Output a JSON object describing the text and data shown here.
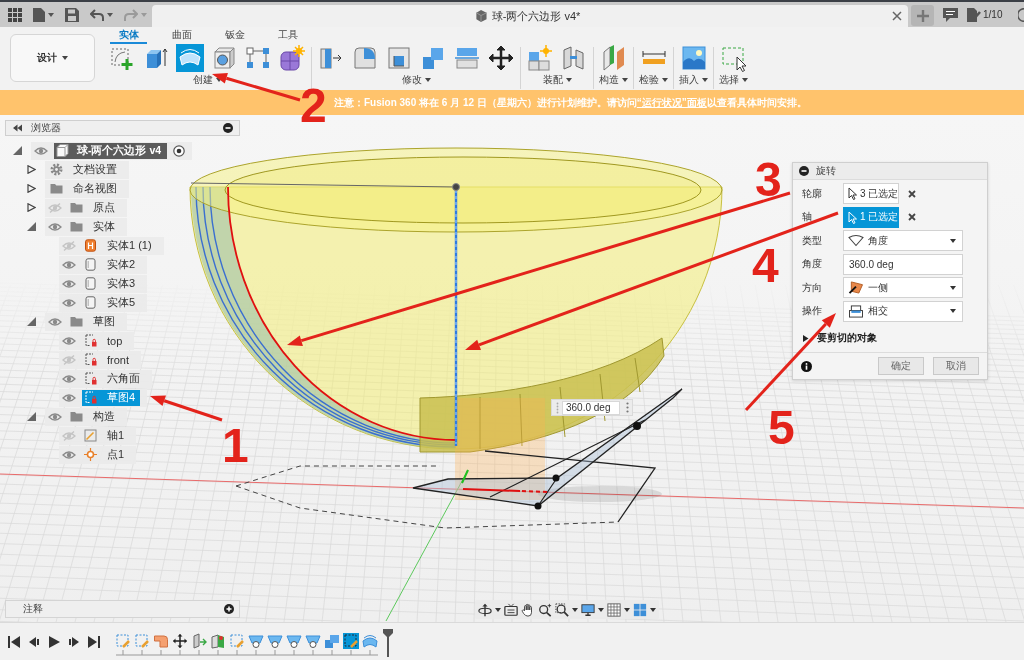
{
  "title_bar": {
    "document_title": "球-两个六边形 v4*",
    "job_count": "1/10"
  },
  "ribbon": {
    "workspace": "设计",
    "tabs": [
      {
        "label": "实体",
        "selected": true
      },
      {
        "label": "曲面",
        "selected": false
      },
      {
        "label": "钣金",
        "selected": false
      },
      {
        "label": "工具",
        "selected": false
      }
    ],
    "groups": [
      {
        "label": "创建",
        "tools": [
          {
            "kind": "sketch",
            "selected": false
          },
          {
            "kind": "extrude",
            "selected": false
          },
          {
            "kind": "revolve",
            "selected": true
          },
          {
            "kind": "hole",
            "selected": false
          },
          {
            "kind": "pattern",
            "selected": false
          },
          {
            "kind": "form",
            "selected": false
          }
        ]
      },
      {
        "label": "修改",
        "tools": [
          {
            "kind": "presspull",
            "selected": false
          },
          {
            "kind": "fillet",
            "selected": false
          },
          {
            "kind": "shell",
            "selected": false
          },
          {
            "kind": "combine",
            "selected": false
          },
          {
            "kind": "replace",
            "selected": false
          },
          {
            "kind": "move",
            "selected": false
          }
        ]
      },
      {
        "label": "装配",
        "tools": [
          {
            "kind": "component",
            "selected": false
          },
          {
            "kind": "joint",
            "selected": false
          }
        ]
      },
      {
        "label": "构造",
        "tools": [
          {
            "kind": "plane",
            "selected": false
          }
        ]
      },
      {
        "label": "检验",
        "tools": [
          {
            "kind": "measure",
            "selected": false
          }
        ]
      },
      {
        "label": "插入",
        "tools": [
          {
            "kind": "image",
            "selected": false
          }
        ]
      },
      {
        "label": "选择",
        "tools": [
          {
            "kind": "select",
            "selected": false
          }
        ]
      }
    ]
  },
  "banner": {
    "text": "注意：Fusion 360 将在 6 月 12 日（星期六）进行计划维护。请访问",
    "link": "“运行状况”面板",
    "text_after": "以查看具体时间安排。"
  },
  "browser": {
    "title": "浏览器",
    "tree": [
      {
        "label": "球-两个六边形 v4",
        "kind": "component",
        "visible": true,
        "expanded": true,
        "selected": false,
        "children": [
          {
            "label": "文档设置",
            "kind": "settings",
            "expanded": false,
            "selected": false
          },
          {
            "label": "命名视图",
            "kind": "folder",
            "expanded": false,
            "selected": false
          },
          {
            "label": "原点",
            "kind": "folder",
            "visible": false,
            "expanded": false,
            "selected": false
          },
          {
            "label": "实体",
            "kind": "folder",
            "visible": true,
            "expanded": true,
            "selected": false,
            "children": [
              {
                "label": "实体1 (1)",
                "kind": "solid",
                "visible": false,
                "selected": false
              },
              {
                "label": "实体2",
                "kind": "body",
                "visible": true,
                "selected": false
              },
              {
                "label": "实体3",
                "kind": "body",
                "visible": true,
                "selected": false
              },
              {
                "label": "实体5",
                "kind": "body",
                "visible": true,
                "selected": false
              }
            ]
          },
          {
            "label": "草图",
            "kind": "folder",
            "visible": true,
            "expanded": true,
            "selected": false,
            "children": [
              {
                "label": "top",
                "kind": "sketch",
                "visible": true,
                "selected": false
              },
              {
                "label": "front",
                "kind": "sketch",
                "visible": false,
                "selected": false
              },
              {
                "label": "六角面",
                "kind": "sketch",
                "visible": true,
                "selected": false
              },
              {
                "label": "草图4",
                "kind": "sketch",
                "visible": true,
                "selected": true
              }
            ]
          },
          {
            "label": "构造",
            "kind": "folder",
            "visible": true,
            "expanded": true,
            "selected": false,
            "children": [
              {
                "label": "轴1",
                "kind": "axis",
                "visible": false,
                "selected": false
              },
              {
                "label": "点1",
                "kind": "point",
                "visible": true,
                "selected": false
              }
            ]
          }
        ]
      }
    ]
  },
  "comments_panel": {
    "title": "注释"
  },
  "dialog": {
    "title": "旋转",
    "rows": [
      {
        "kind": "selection",
        "label": "轮廓",
        "value": "3 已选定",
        "selected": false
      },
      {
        "kind": "selection",
        "label": "轴",
        "value": "1 已选定",
        "selected": true
      },
      {
        "kind": "dropdown",
        "label": "类型",
        "value": "角度"
      },
      {
        "kind": "input",
        "label": "角度",
        "value": "360.0 deg"
      },
      {
        "kind": "dropdown",
        "label": "方向",
        "value": "一侧"
      },
      {
        "kind": "dropdown",
        "label": "操作",
        "value": "相交"
      }
    ],
    "section": {
      "label": "要剪切的对象",
      "expanded": false
    },
    "buttons": [
      {
        "label": "确定"
      },
      {
        "label": "取消"
      }
    ]
  },
  "viewport": {
    "angle_value": "360.0 deg"
  },
  "timeline": [
    {
      "kind": "sketch",
      "selected": false
    },
    {
      "kind": "sketch",
      "selected": false
    },
    {
      "kind": "extrude",
      "selected": false
    },
    {
      "kind": "move",
      "selected": false
    },
    {
      "kind": "presspull",
      "selected": false
    },
    {
      "kind": "split",
      "selected": false
    },
    {
      "kind": "sketch",
      "selected": false
    },
    {
      "kind": "hole",
      "selected": false
    },
    {
      "kind": "hole",
      "selected": false
    },
    {
      "kind": "hole",
      "selected": false
    },
    {
      "kind": "hole",
      "selected": false
    },
    {
      "kind": "combine",
      "selected": false
    },
    {
      "kind": "sketch",
      "selected": true
    },
    {
      "kind": "revolve",
      "selected": false
    }
  ],
  "annotations": [
    {
      "label": "1"
    },
    {
      "label": "2"
    },
    {
      "label": "3"
    },
    {
      "label": "4"
    },
    {
      "label": "5"
    }
  ]
}
